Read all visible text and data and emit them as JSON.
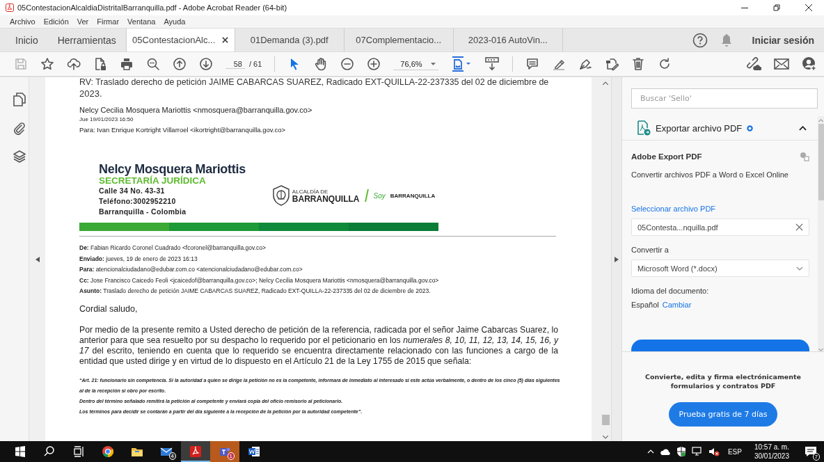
{
  "window": {
    "title": "05ContestacionAlcaldiaDistritalBarranquilla.pdf - Adobe Acrobat Reader (64-bit)"
  },
  "menu": [
    "Archivo",
    "Edición",
    "Ver",
    "Firmar",
    "Ventana",
    "Ayuda"
  ],
  "tabs": [
    {
      "label": "Inicio",
      "kind": "nav",
      "selected": false
    },
    {
      "label": "Herramientas",
      "kind": "nav",
      "selected": false
    },
    {
      "label": "05ContestacionAlc...",
      "kind": "doc",
      "selected": true
    },
    {
      "label": "01Demanda (3).pdf",
      "kind": "doc",
      "selected": false
    },
    {
      "label": "07Complementacio...",
      "kind": "doc",
      "selected": false
    },
    {
      "label": "2023-016 AutoVin...",
      "kind": "doc",
      "selected": false
    }
  ],
  "sign_in": "Iniciar sesión",
  "toolbar": {
    "tools_left": [
      {
        "kind": "save",
        "disabled": true
      },
      {
        "kind": "star",
        "disabled": false
      },
      {
        "kind": "upload",
        "disabled": false
      },
      {
        "kind": "filelock",
        "disabled": false
      },
      {
        "kind": "print",
        "disabled": false
      },
      {
        "kind": "zoomsearch",
        "disabled": false
      },
      {
        "kind": "up",
        "disabled": false
      },
      {
        "kind": "down",
        "disabled": false
      }
    ],
    "page_current": "58",
    "page_total": "/ 61",
    "modes": [
      {
        "kind": "pointer",
        "selected": true
      },
      {
        "kind": "hand",
        "selected": false
      }
    ],
    "zoom": "76,6%",
    "tools_right": [
      {
        "kind": "comment",
        "disabled": false
      },
      {
        "kind": "highlight",
        "disabled": false
      },
      {
        "kind": "sign",
        "disabled": false
      },
      {
        "kind": "editfile",
        "disabled": false
      },
      {
        "kind": "trash",
        "disabled": false
      },
      {
        "kind": "redo",
        "disabled": false
      }
    ]
  },
  "document": {
    "cut_line": "RV: Traslado derecho de petición JAIME CABARCAS SUAREZ, Radicado EXT-QUILLA-22-237335 del 02 de diciembre de",
    "cut_line_end": "2023.",
    "sender": "Nelcy Cecilia Mosquera Mariottis <nmosquera@barranquilla.gov.co>",
    "date": "Jue 19/01/2023 16:50",
    "to": "Para: Ivan Enrique Kortright Villarroel <ikortright@barranquilla.gov.co>",
    "signature": {
      "name": "Nelcy Mosquera Mariottis",
      "office": "SECRETARÍA JURÍDICA",
      "lines": [
        "Calle 34 No. 43-31",
        "Teléfono:3002952210",
        "Barranquilla - Colombia"
      ],
      "logo_small": "ALCALDÍA DE",
      "logo_big": "BARRANQUILLA",
      "slogan": "Soy",
      "slogan_city": "BARRANQUILLA"
    },
    "headers": [
      "**De:** Fabian Ricardo Coronel Cuadrado <fcoronel@barranquilla.gov.co>",
      "**Enviado:** jueves, 19 de enero de 2023 16:13",
      "**Para:** atencionalciudadano@edubar.com.co <atencionalciudadano@edubar.com.co>",
      "**Cc:** Jose Francisco Caicedo Feoli <jcaicedof@barranquilla.gov.co>; Nelcy Cecilia Mosquera Mariottis <nmosquera@barranquilla.gov.co>",
      "**Asunto:** Traslado derecho de petición JAIME CABARCAS SUAREZ, Radicado EXT-QUILLA-22-237335 del 02 de diciembre de 2023."
    ],
    "greeting": "Cordial saludo,",
    "body": "Por medio de la presente remito a Usted derecho de petición de la referencia, radicada por el señor Jaime Cabarcas Suarez, lo anterior para que sea resuelto por su despacho lo requerido por el peticionario en los *numerales 8, 10, 11, 12, 13, 14, 15, 16, y 17* del escrito, teniendo en cuenta que lo requerido se encuentra directamente relacionado con las funciones a cargo de la entidad que usted dirige y en virtud de lo dispuesto en el Artículo 21 de la Ley 1755 de 2015 que señala:",
    "quote": [
      "“Art. 21: funcionario sin competencia. Si la autoridad a quien se dirige la petición no es la competente, informara de inmediato al interesado si este actúa verbalmente, o dentro de los cinco (5) días siguientes al de la recepción si obro por escrito.",
      "Dentro del término señalado remitirá la petición al competente y enviará copia del oficio remisorio al peticionario.",
      "Los términos para decidir se contarán a partir del día siguiente a la recepción de la petición por la autoridad competente”."
    ]
  },
  "panel": {
    "search": {
      "placeholder": "Buscar 'Sello'"
    },
    "section": {
      "title": "Exportar archivo PDF",
      "expanded": true
    },
    "heading": "Adobe Export PDF",
    "description": "Convertir archivos PDF a Word o Excel Online",
    "select_link": "Seleccionar archivo PDF",
    "file": "05Contesta...nquilla.pdf",
    "convert_label": "Convertir a",
    "convert_value": "Microsoft Word (*.docx)",
    "language_label": "Idioma del documento:",
    "language": "Español",
    "change_link": "Cambiar",
    "promo": "Convierte, edita y firma electrónicamente formularios y contratos PDF",
    "trial_button": "Prueba gratis de 7 días"
  },
  "taskbar": {
    "apps": [
      {
        "kind": "windows",
        "selected": false,
        "attention": false
      },
      {
        "kind": "search",
        "selected": false,
        "attention": false
      },
      {
        "kind": "taskview",
        "selected": false,
        "attention": false
      },
      {
        "kind": "chrome",
        "selected": false,
        "attention": false
      },
      {
        "kind": "folder",
        "selected": false,
        "attention": false
      },
      {
        "kind": "mail",
        "selected": false,
        "attention": false,
        "badge": "4"
      },
      {
        "kind": "acrobat",
        "selected": true,
        "attention": false
      },
      {
        "kind": "teams",
        "selected": false,
        "attention": true,
        "badge": "1"
      },
      {
        "kind": "word",
        "selected": false,
        "attention": false
      }
    ],
    "language": "ESP",
    "time": "10:57 a. m.",
    "date": "30/01/2023",
    "notifications": "7"
  }
}
